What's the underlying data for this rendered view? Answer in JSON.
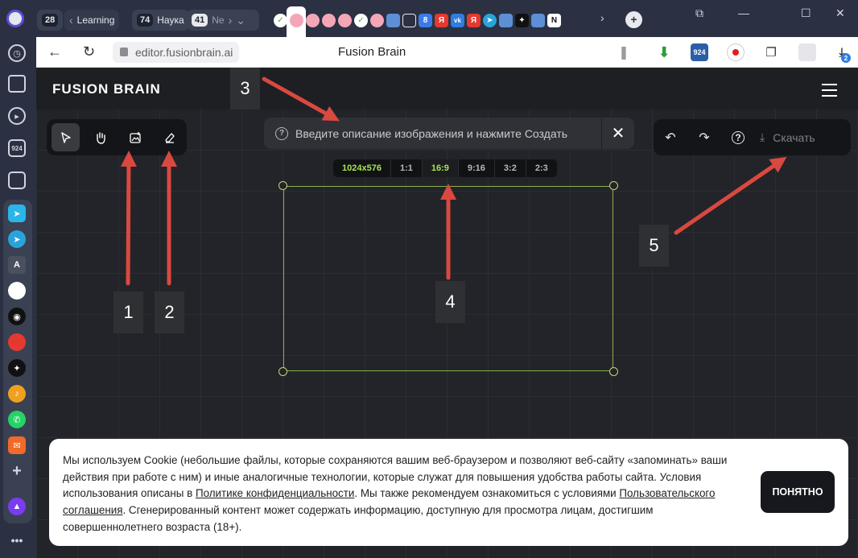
{
  "browser": {
    "tab_groups": [
      {
        "count": "28",
        "label": ""
      },
      {
        "count": "",
        "label": "Learning"
      },
      {
        "count": "74",
        "label": "Наука"
      },
      {
        "count": "41",
        "label": "Ne"
      }
    ],
    "tab_icons": [
      "ya-icon",
      "vk-icon",
      "telegram-icon",
      "tab-icon"
    ],
    "tab_icon_labels": [
      "8",
      "Я",
      "vk",
      "Я"
    ],
    "url": "editor.fusionbrain.ai",
    "page_title": "Fusion Brain",
    "ext_badge": "924",
    "downloads_badge": "2"
  },
  "sidebar": {
    "badge": "924"
  },
  "app": {
    "brand": "FUSION BRAIN",
    "prompt_placeholder": "Введите описание изображения и нажмите Создать",
    "ratios": [
      "1024x576",
      "1:1",
      "16:9",
      "9:16",
      "3:2",
      "2:3"
    ],
    "selected_ratio": "16:9",
    "download_label": "Скачать"
  },
  "annotations": [
    "1",
    "2",
    "3",
    "4",
    "5"
  ],
  "cookie": {
    "text_1": "Мы используем Cookie (небольшие файлы, которые сохраняются вашим веб-браузером и позволяют веб-сайту «запоминать» ваши действия при работе с ним) и иные аналогичные технологии, которые служат для повышения удобства работы сайта. Условия использования описаны в ",
    "link_1": "Политике конфиденциальности",
    "text_2": ". Мы также рекомендуем ознакомиться с условиями ",
    "link_2": "Пользовательского соглашения",
    "text_3": ". Сгенерированный контент может содержать информацию, доступную для просмотра лицам, достигшим совершеннолетнего возраста (18+).",
    "button": "ПОНЯТНО"
  },
  "colors": {
    "accent_green": "#a6e255",
    "frame": "#8cb04a",
    "arrow": "#d9493f"
  }
}
